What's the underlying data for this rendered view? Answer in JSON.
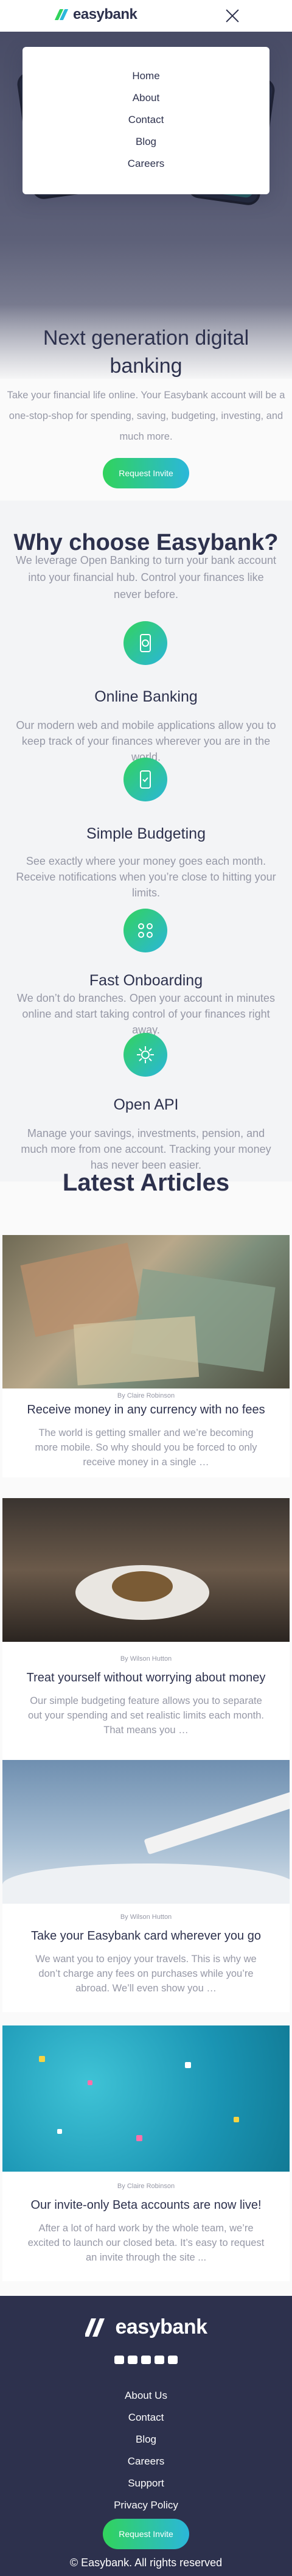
{
  "header": {
    "brand": "easybank",
    "close_icon": "close-icon"
  },
  "menu": {
    "items": [
      "Home",
      "About",
      "Contact",
      "Blog",
      "Careers"
    ]
  },
  "hero": {
    "title": "Next generation digital banking",
    "text": "Take your financial life online. Your Easybank account will be a one-stop-shop for spending, saving, budgeting, investing, and much more.",
    "cta": "Request Invite"
  },
  "why": {
    "title": "Why choose Easybank?",
    "text": "We leverage Open Banking to turn your bank account into your financial hub. Control your finances like never before.",
    "features": [
      {
        "icon": "online-banking-icon",
        "title": "Online Banking",
        "text": "Our modern web and mobile applications allow you to keep track of your finances wherever you are in the world."
      },
      {
        "icon": "budgeting-icon",
        "title": "Simple Budgeting",
        "text": "See exactly where your money goes each month. Receive notifications when you’re close to hitting your limits."
      },
      {
        "icon": "onboarding-icon",
        "title": "Fast Onboarding",
        "text": "We don’t do branches. Open your account in minutes online and start taking control of your finances right away."
      },
      {
        "icon": "api-icon",
        "title": "Open API",
        "text": "Manage your savings, investments, pension, and much more from one account. Tracking your money has never been easier."
      }
    ]
  },
  "articles": {
    "title": "Latest Articles",
    "items": [
      {
        "author": "By Claire Robinson",
        "title": "Receive money in any currency with no fees",
        "desc": "The world is getting smaller and we’re becoming more mobile. So why should you be forced to only receive money in a single …"
      },
      {
        "author": "By Wilson Hutton",
        "title": "Treat yourself without worrying about money",
        "desc": "Our simple budgeting feature allows you to separate out your spending and set realistic limits each month. That means you …"
      },
      {
        "author": "By Wilson Hutton",
        "title": "Take your Easybank card wherever you go",
        "desc": "We want you to enjoy your travels. This is why we don’t charge any fees on purchases while you’re abroad. We’ll even show you …"
      },
      {
        "author": "By Claire Robinson",
        "title": "Our invite-only Beta accounts are now live!",
        "desc": "After a lot of hard work by the whole team, we’re excited to launch our closed beta. It’s easy to request an invite through the site ..."
      }
    ]
  },
  "footer": {
    "brand": "easybank",
    "socials": [
      "facebook-icon",
      "youtube-icon",
      "twitter-icon",
      "pinterest-icon",
      "instagram-icon"
    ],
    "links": [
      "About Us",
      "Contact",
      "Blog",
      "Careers",
      "Support",
      "Privacy Policy"
    ],
    "cta": "Request Invite",
    "copyright": "© Easybank. All rights reserved"
  },
  "colors": {
    "dark_blue": "#2d314d",
    "lime_green": "#31d35c",
    "bright_cyan": "#2bb7da",
    "grayish_blue": "#9698a6"
  }
}
